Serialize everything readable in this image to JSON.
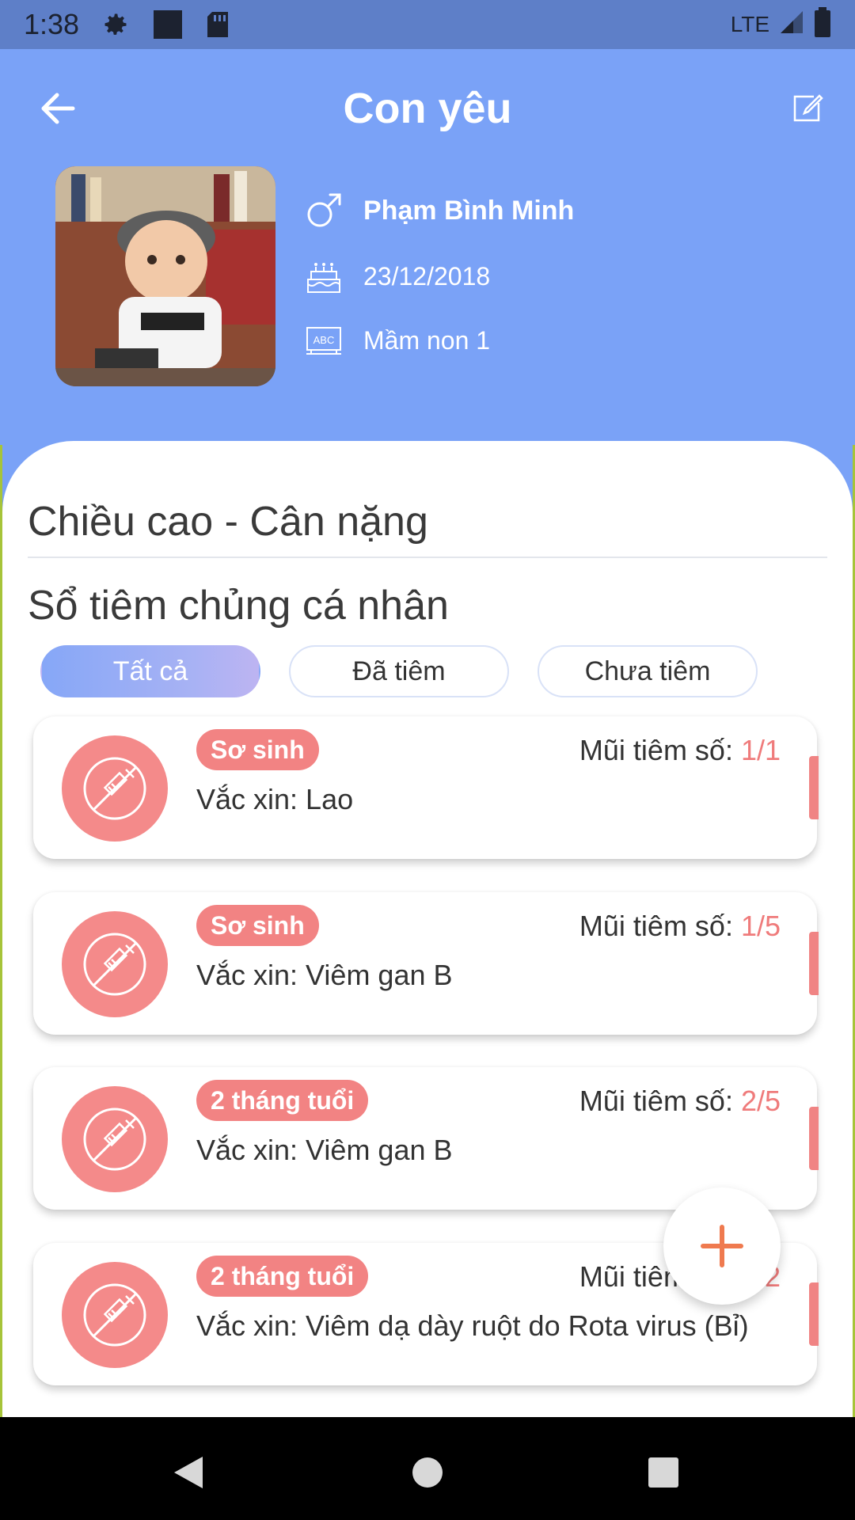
{
  "status_bar": {
    "time": "1:38",
    "network": "LTE"
  },
  "header": {
    "title": "Con yêu",
    "child_name": "Phạm Bình Minh",
    "birth_date": "23/12/2018",
    "class_name": "Mầm non 1"
  },
  "sections": {
    "height_weight": "Chiều cao - Cân nặng",
    "vaccination_book": "Sổ tiêm chủng cá nhân"
  },
  "filters": {
    "all": "Tất cả",
    "done": "Đã tiêm",
    "not_done": "Chưa tiêm",
    "selected": "all"
  },
  "dose_label": "Mũi tiêm số: ",
  "cards": [
    {
      "badge": "Sơ sinh",
      "dose": "1/1",
      "vaccine": "Vắc xin: Lao"
    },
    {
      "badge": "Sơ sinh",
      "dose": "1/5",
      "vaccine": "Vắc xin: Viêm gan B"
    },
    {
      "badge": "2 tháng tuổi",
      "dose": "2/5",
      "vaccine": "Vắc xin: Viêm gan B"
    },
    {
      "badge": "2 tháng tuổi",
      "dose": "2/2",
      "vaccine": "Vắc xin: Viêm dạ dày ruột do Rota virus (Bỉ)"
    }
  ],
  "colors": {
    "header": "#7aa2f7",
    "accent": "#f28383",
    "fab_plus": "#ef7a4f"
  },
  "icons": {
    "back": "arrow-left-icon",
    "edit": "edit-icon",
    "gender": "male-icon",
    "birthday": "cake-icon",
    "class": "abc-board-icon",
    "vaccine": "no-syringe-icon",
    "add": "plus-icon"
  }
}
